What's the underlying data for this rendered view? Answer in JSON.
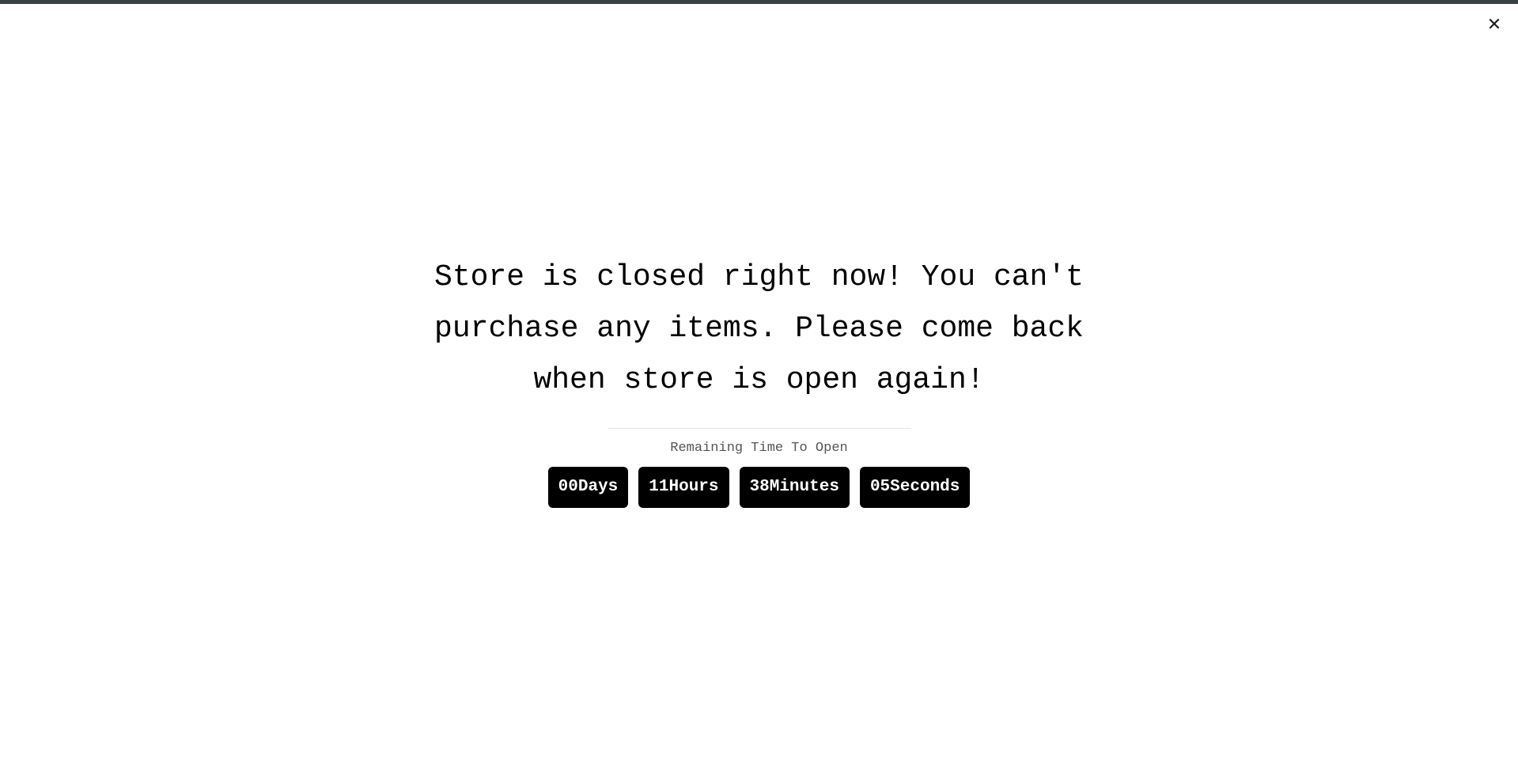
{
  "theme": {
    "page_background": "#ffffff",
    "top_bar_color": "#3a3f42",
    "text_color": "#000000",
    "muted_text_color": "#555555",
    "divider_color": "#e5e5e5",
    "badge_background": "#000000",
    "badge_text_color": "#ffffff"
  },
  "header": {
    "close_icon": "close-icon",
    "close_glyph": "✕"
  },
  "notice": {
    "message": "Store is closed right now! You can't purchase any items. Please come back when store is open again!"
  },
  "countdown": {
    "label": "Remaining Time To Open",
    "units": [
      {
        "value": "00",
        "unit": "Days"
      },
      {
        "value": "11",
        "unit": "Hours"
      },
      {
        "value": "38",
        "unit": "Minutes"
      },
      {
        "value": "05",
        "unit": "Seconds"
      }
    ]
  }
}
